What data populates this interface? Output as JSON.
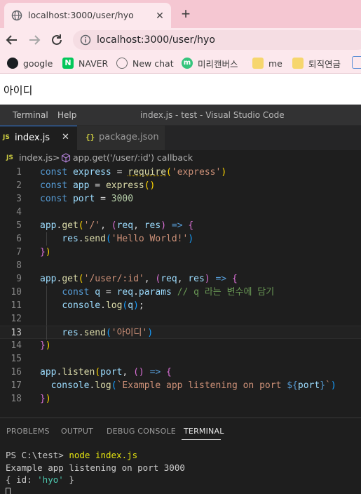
{
  "browser": {
    "tab_title": "localhost:3000/user/hyo",
    "url": "localhost:3000/user/hyo",
    "bookmarks": [
      {
        "label": "google",
        "icon": "github-icon"
      },
      {
        "label": "NAVER",
        "icon": "naver-icon"
      },
      {
        "label": "New chat",
        "icon": "openai-icon"
      },
      {
        "label": "미리캔버스",
        "icon": "miricanvas-icon"
      },
      {
        "label": "me",
        "icon": "folder-icon"
      },
      {
        "label": "퇴직연금",
        "icon": "folder-icon"
      }
    ]
  },
  "page": {
    "body_text": "아이디"
  },
  "vscode": {
    "menu": [
      "Terminal",
      "Help"
    ],
    "window_title": "index.js - test - Visual Studio Code",
    "tabs": [
      {
        "label": "index.js",
        "badge": "JS",
        "active": true
      },
      {
        "label": "package.json",
        "badge": "{}",
        "active": false
      }
    ],
    "breadcrumb": {
      "file": "index.js",
      "separator": ">",
      "symbol": "app.get('/user/:id') callback"
    },
    "active_line": 13,
    "line_numbers": [
      "1",
      "2",
      "3",
      "4",
      "5",
      "6",
      "7",
      "8",
      "9",
      "10",
      "11",
      "12",
      "13",
      "14",
      "15",
      "16",
      "17",
      "18"
    ],
    "panel_tabs": [
      "PROBLEMS",
      "OUTPUT",
      "DEBUG CONSOLE",
      "TERMINAL"
    ],
    "active_panel_tab": "TERMINAL",
    "terminal": {
      "prompt": "PS C:\\test> ",
      "command": "node index.js",
      "output_line": "Example app listening on port 3000",
      "obj_open": "{ id: ",
      "obj_value": "'hyo'",
      "obj_close": " }"
    }
  },
  "colors": {
    "tabbar": "#f5c7d2",
    "toolbar": "#fce8ed",
    "editor_bg": "#1e1e1e",
    "keyword": "#569cd6",
    "string": "#ce9178",
    "comment": "#6a9955"
  }
}
